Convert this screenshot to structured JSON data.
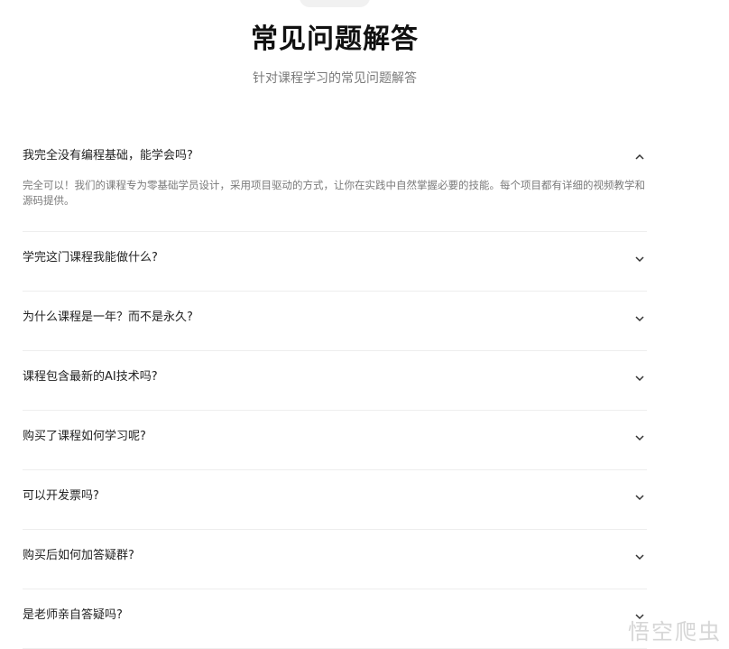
{
  "header": {
    "title": "常见问题解答",
    "subtitle": "针对课程学习的常见问题解答"
  },
  "faq": [
    {
      "question": "我完全没有编程基础，能学会吗?",
      "answer": "完全可以！我们的课程专为零基础学员设计，采用项目驱动的方式，让你在实践中自然掌握必要的技能。每个项目都有详细的视频教学和源码提供。",
      "expanded": true
    },
    {
      "question": "学完这门课程我能做什么?",
      "expanded": false
    },
    {
      "question": "为什么课程是一年？而不是永久?",
      "expanded": false
    },
    {
      "question": "课程包含最新的AI技术吗?",
      "expanded": false
    },
    {
      "question": "购买了课程如何学习呢?",
      "expanded": false
    },
    {
      "question": "可以开发票吗?",
      "expanded": false
    },
    {
      "question": "购买后如何加答疑群?",
      "expanded": false
    },
    {
      "question": "是老师亲自答疑吗?",
      "expanded": false
    }
  ],
  "icons": {
    "expanded": "chevron-up-icon",
    "collapsed": "chevron-down-icon"
  },
  "watermark": "悟空爬虫"
}
